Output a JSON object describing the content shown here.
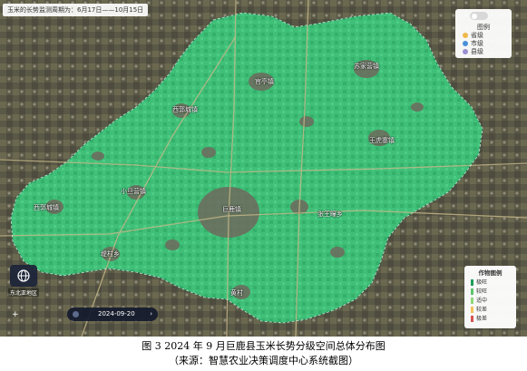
{
  "top_note": "玉米的长势监测周期为：6月17日——10月15日",
  "legend": {
    "title": "图例",
    "items": [
      {
        "label": "省级",
        "color": "#f0b84a"
      },
      {
        "label": "市级",
        "color": "#4a90d9"
      },
      {
        "label": "县级",
        "color": "#9b8fd1"
      }
    ]
  },
  "place_labels": {
    "guanzhuang": "官亭镇",
    "sujiaying": "苏家营镇",
    "xiyunzhen": "西郭城镇",
    "wangzhuang": "王虎寨镇",
    "xiaozhangzhuang": "小旦营镇",
    "juluzhen": "巨鹿镇",
    "zhangwangdong": "张王疃乡",
    "xiguocheng": "西郭城镇",
    "shangzhuang": "堤村乡",
    "changhuang": "阎疃镇",
    "huangcun": "黄村"
  },
  "bottom_left_text": "东北亚地区",
  "timeline": {
    "date": "2024-09-20"
  },
  "growth_legend": {
    "title": "作物图例",
    "items": [
      {
        "label": "极旺",
        "color": "#1e9e5a"
      },
      {
        "label": "较旺",
        "color": "#5fc46c"
      },
      {
        "label": "适中",
        "color": "#8fd87a"
      },
      {
        "label": "较差",
        "color": "#f2c35a"
      },
      {
        "label": "极差",
        "color": "#d9534f"
      }
    ]
  },
  "caption": {
    "line1": "图 3 2024 年 9 月巨鹿县玉米长势分级空间总体分布图",
    "line2": "（来源：智慧农业决策调度中心系统截图）"
  }
}
